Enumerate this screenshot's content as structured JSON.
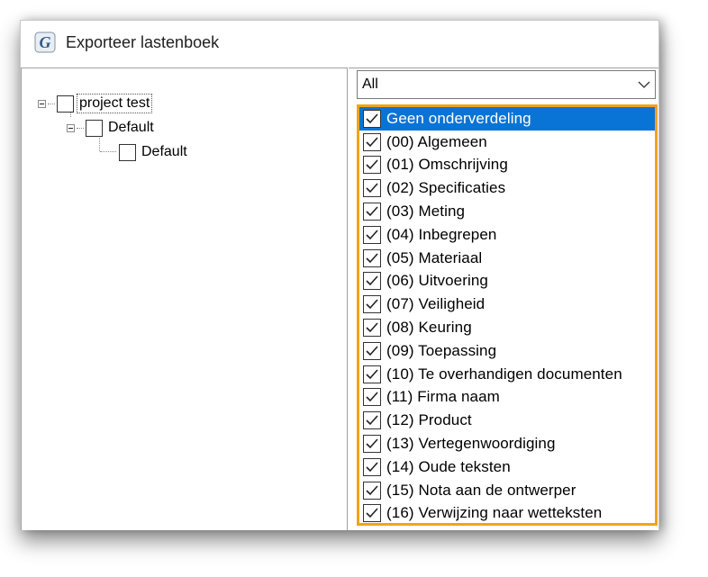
{
  "window": {
    "title": "Exporteer lastenboek"
  },
  "tree": {
    "root": {
      "label": "project test",
      "checked": false,
      "expanded": true
    },
    "child": {
      "label": "Default",
      "checked": false,
      "expanded": true
    },
    "grandchild": {
      "label": "Default",
      "checked": false
    }
  },
  "filter": {
    "selected": "All"
  },
  "chapters": [
    {
      "label": "Geen onderverdeling",
      "checked": true,
      "selected": true
    },
    {
      "label": "(00)  Algemeen",
      "checked": true
    },
    {
      "label": "(01)  Omschrijving",
      "checked": true
    },
    {
      "label": "(02)  Specificaties",
      "checked": true
    },
    {
      "label": "(03)  Meting",
      "checked": true
    },
    {
      "label": "(04)  Inbegrepen",
      "checked": true
    },
    {
      "label": "(05)  Materiaal",
      "checked": true
    },
    {
      "label": "(06)  Uitvoering",
      "checked": true
    },
    {
      "label": "(07)  Veiligheid",
      "checked": true
    },
    {
      "label": "(08)  Keuring",
      "checked": true
    },
    {
      "label": "(09)  Toepassing",
      "checked": true
    },
    {
      "label": "(10)  Te overhandigen documenten",
      "checked": true
    },
    {
      "label": "(11)  Firma naam",
      "checked": true
    },
    {
      "label": "(12)  Product",
      "checked": true
    },
    {
      "label": "(13)  Vertegenwoordiging",
      "checked": true
    },
    {
      "label": "(14)  Oude teksten",
      "checked": true
    },
    {
      "label": "(15)  Nota aan de ontwerper",
      "checked": true
    },
    {
      "label": "(16)  Verwijzing naar wetteksten",
      "checked": true
    }
  ],
  "colors": {
    "highlight": "#f0a419",
    "selection": "#0a74d6"
  }
}
